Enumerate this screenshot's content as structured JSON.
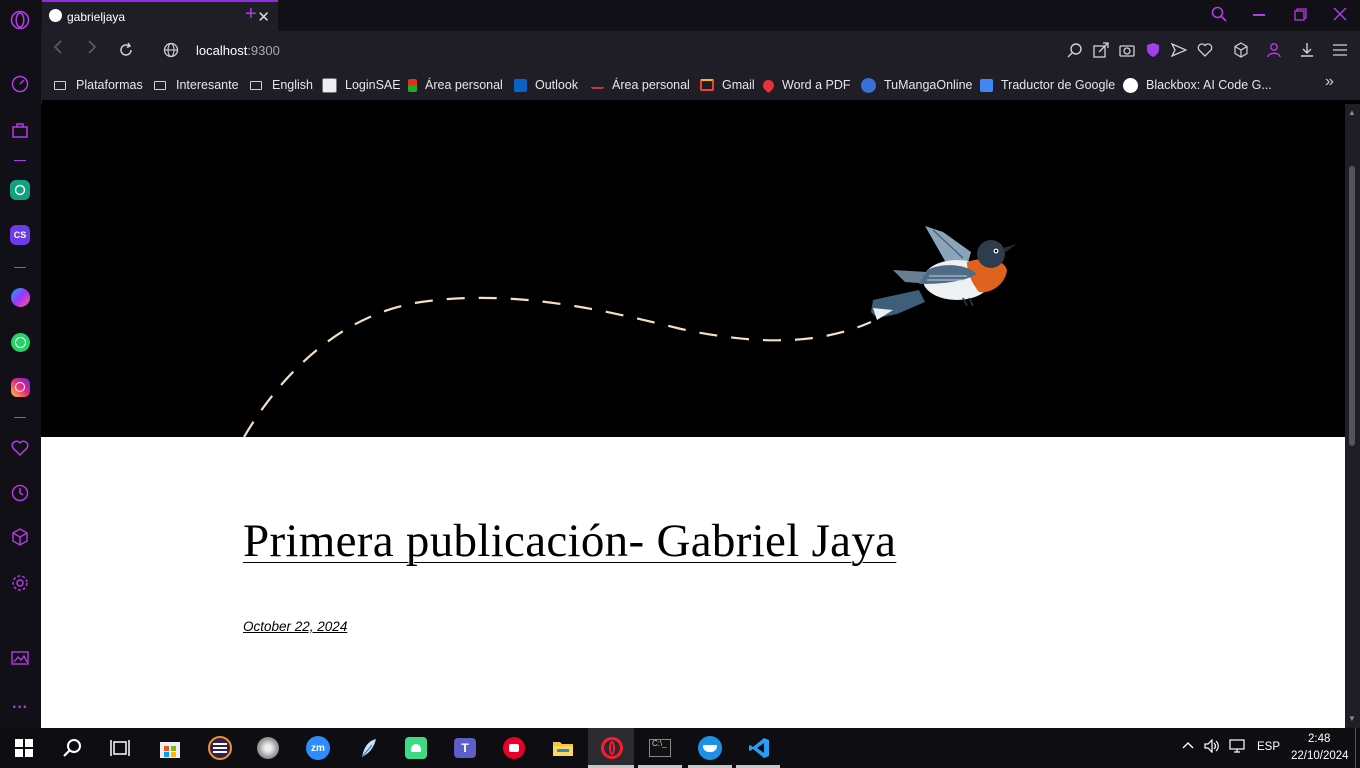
{
  "browser": {
    "tab": {
      "title": "gabrieljaya",
      "close": "✕"
    },
    "new_tab": "+",
    "address": {
      "host": "localhost",
      "port": ":9300"
    },
    "bookmarks": [
      {
        "label": "Plataformas",
        "icon": "folder-icon"
      },
      {
        "label": "Interesante",
        "icon": "folder-icon"
      },
      {
        "label": "English",
        "icon": "folder-icon"
      },
      {
        "label": "LoginSAE",
        "icon": "loginsae-icon"
      },
      {
        "label": "Área personal",
        "icon": "area-personal-icon"
      },
      {
        "label": "Outlook",
        "icon": "outlook-icon"
      },
      {
        "label": "Área personal",
        "icon": "area-personal-2-icon"
      },
      {
        "label": "Gmail",
        "icon": "gmail-icon"
      },
      {
        "label": "Word a PDF",
        "icon": "heart-pdf-icon"
      },
      {
        "label": "TuMangaOnline",
        "icon": "tmo-icon"
      },
      {
        "label": "Traductor de Google",
        "icon": "google-translate-icon"
      },
      {
        "label": "Blackbox: AI Code G...",
        "icon": "blackbox-icon"
      }
    ],
    "more_bookmarks": "»"
  },
  "page": {
    "post_title": "Primera publicación- Gabriel Jaya",
    "post_date": "October 22, 2024"
  },
  "taskbar": {
    "language": "ESP",
    "time": "2:48",
    "date": "22/10/2024"
  },
  "colors": {
    "accent": "#b23be6",
    "browser_bg": "#111016",
    "toolbar_bg": "#1f1e26"
  }
}
